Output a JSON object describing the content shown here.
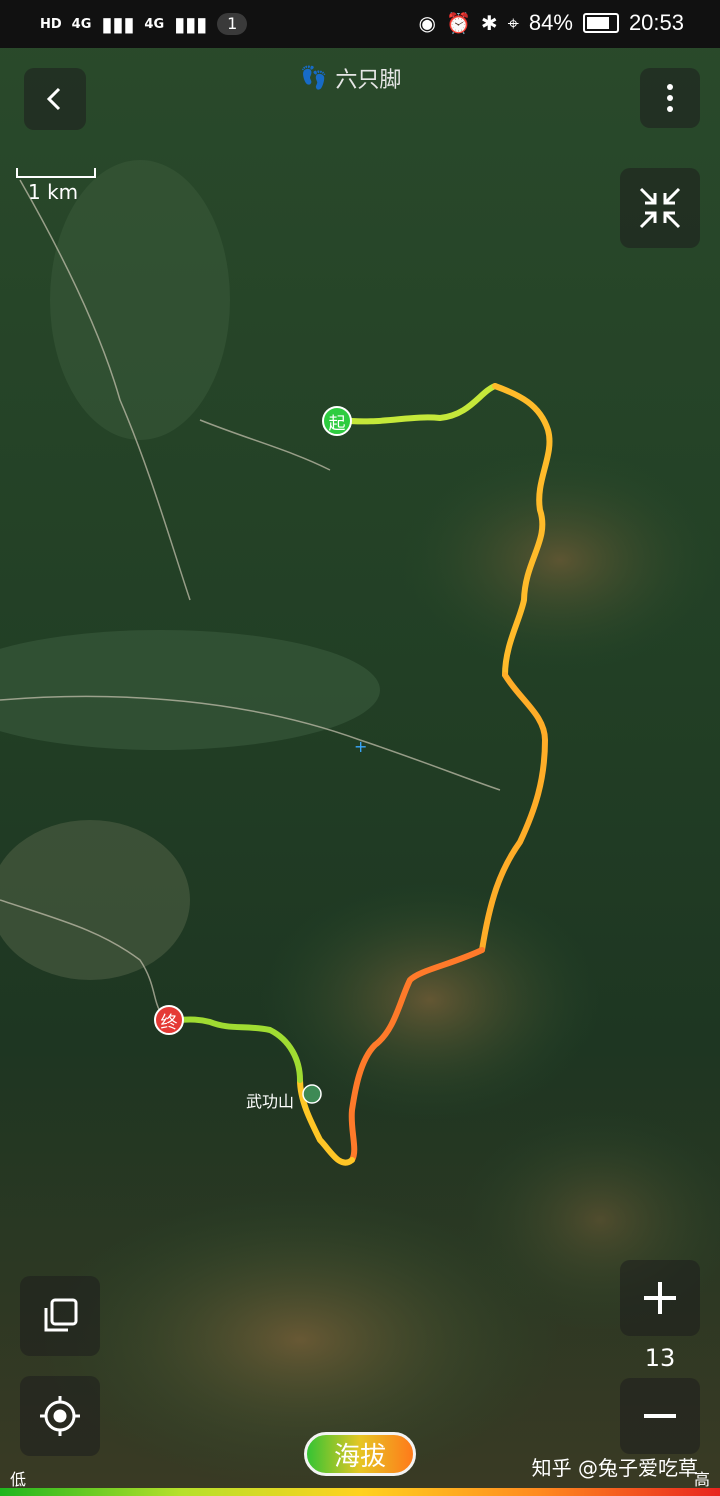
{
  "status_bar": {
    "network": [
      "4G",
      "4G"
    ],
    "badge": "1",
    "battery": "84%",
    "time": "20:53"
  },
  "app": {
    "title": "六只脚"
  },
  "map": {
    "scale_label": "1 km",
    "zoom_level": "13",
    "place_label": "武功山",
    "start_marker": "起",
    "end_marker": "终"
  },
  "legend": {
    "low": "低",
    "high": "高",
    "button": "海拔"
  },
  "watermark": "知乎 @兔子爱吃草",
  "colors": {
    "start": "#2ecc40",
    "end": "#e53935",
    "track_low": "#8de03a",
    "track_mid": "#ffb229",
    "track_high": "#ff6a2a"
  },
  "icons": {
    "back": "chevron-left-icon",
    "menu": "more-vertical-icon",
    "collapse": "collapse-arrows-icon",
    "layers": "layers-icon",
    "locate": "target-icon",
    "zoom_in": "plus-icon",
    "zoom_out": "minus-icon"
  }
}
